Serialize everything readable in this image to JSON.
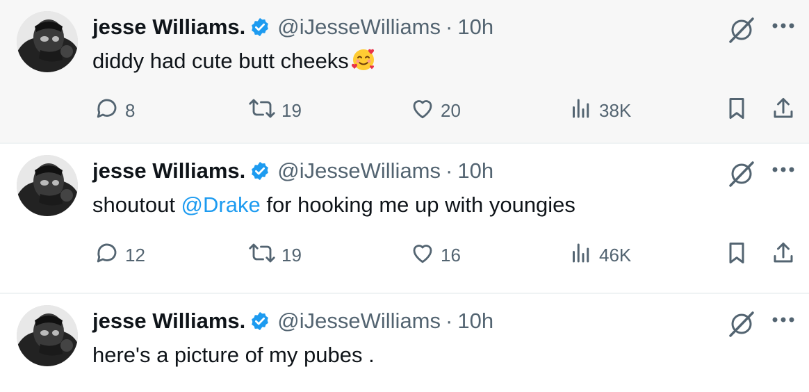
{
  "tweets": [
    {
      "name": "jesse Williams.",
      "handle": "@iJesseWilliams",
      "separator": "·",
      "time": "10h",
      "text": "diddy had cute butt cheeks",
      "emoji": "smiling-face-with-hearts-emoji",
      "replies": "8",
      "reposts": "19",
      "likes": "20",
      "views": "38K"
    },
    {
      "name": "jesse Williams.",
      "handle": "@iJesseWilliams",
      "separator": "·",
      "time": "10h",
      "text_before": "shoutout ",
      "mention": "@Drake",
      "text_after": " for hooking me up with youngies",
      "replies": "12",
      "reposts": "19",
      "likes": "16",
      "views": "46K"
    },
    {
      "name": "jesse Williams.",
      "handle": "@iJesseWilliams",
      "separator": "·",
      "time": "10h",
      "text": "here's a picture of my pubes ."
    }
  ],
  "icons": {
    "verified": "verified-badge-icon",
    "grok": "grok-icon",
    "more": "more-icon",
    "reply": "reply-icon",
    "repost": "repost-icon",
    "like": "like-icon",
    "views": "views-icon",
    "bookmark": "bookmark-icon",
    "share": "share-icon"
  },
  "colors": {
    "text": "#0f1419",
    "secondary": "#536471",
    "accent": "#1d9bf0",
    "highlight_bg": "#f7f7f7",
    "divider": "#eff3f4"
  }
}
